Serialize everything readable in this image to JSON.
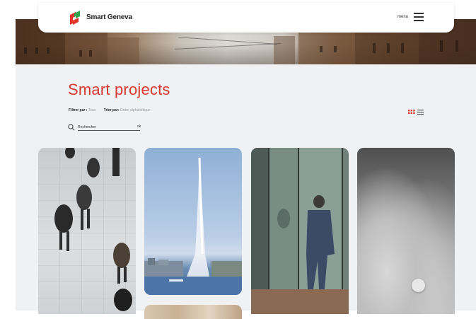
{
  "header": {
    "brand": "Smart Geneva",
    "menu_label": "menu",
    "logo_colors": {
      "red": "#e2342b",
      "green": "#2fa24a"
    }
  },
  "page": {
    "title": "Smart projects",
    "accent_color": "#d63a2f"
  },
  "filters": {
    "filter_label": "Filtrer par :",
    "filter_value": "Tous",
    "sort_label": "Trier par:",
    "sort_value": "Ordre alphabétique"
  },
  "view_toggle": {
    "active": "grid",
    "grid_color": "#d63a2f",
    "list_color": "#555555"
  },
  "search": {
    "placeholder": "Rechercher",
    "submit_label": "ok"
  },
  "icons": [
    "logo-icon",
    "menu-icon",
    "search-icon",
    "grid-view-icon",
    "list-view-icon"
  ],
  "cards": [
    {
      "name": "pedestrians-photo"
    },
    {
      "name": "jet-deau-photo"
    },
    {
      "name": "man-at-glass-facade-photo"
    },
    {
      "name": "clouds-photo"
    }
  ]
}
